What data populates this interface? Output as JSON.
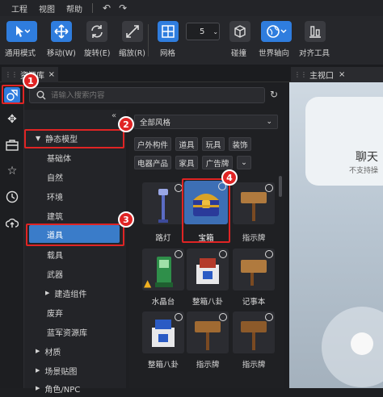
{
  "menu": {
    "items": [
      "工程",
      "视图",
      "帮助"
    ]
  },
  "toolbar": {
    "select_mode": "通用模式",
    "move": "移动(W)",
    "rotate": "旋转(E)",
    "scale": "缩放(R)",
    "grid": "网格",
    "grid_value": "5",
    "collision": "碰撞",
    "world_axis": "世界轴向",
    "align_tool": "对齐工具"
  },
  "tabs": {
    "resource_lib": "资源库",
    "main_viewport": "主视口"
  },
  "search": {
    "placeholder": "请输入搜索内容"
  },
  "tree": {
    "static_models": "静态模型",
    "items": [
      "基础体",
      "自然",
      "环境",
      "建筑",
      "道具",
      "载具",
      "武器"
    ],
    "build_components": "建造组件",
    "abandoned": "废弃",
    "blueprint_lib": "蓝军资源库",
    "material": "材质",
    "scene_texture": "场景贴图",
    "character_npc": "角色/NPC"
  },
  "filter": {
    "style": "全部风格",
    "tags_row1": [
      "户外构件",
      "道具",
      "玩具",
      "装饰"
    ],
    "tags_row2": [
      "电器产品",
      "家具",
      "广告牌"
    ]
  },
  "assets": [
    {
      "label": "路灯"
    },
    {
      "label": "宝箱"
    },
    {
      "label": "指示牌"
    },
    {
      "label": "水晶台"
    },
    {
      "label": "整箱八卦"
    },
    {
      "label": "记事本"
    },
    {
      "label": "整箱八卦"
    },
    {
      "label": "指示牌"
    },
    {
      "label": "指示牌"
    }
  ],
  "annotations": [
    "1",
    "2",
    "3",
    "4"
  ],
  "viewport": {
    "title": "聊天",
    "subtitle": "不支持操"
  },
  "colors": {
    "accent": "#2f7dde",
    "selected": "#3a7cc9",
    "annotation": "#e02424"
  }
}
